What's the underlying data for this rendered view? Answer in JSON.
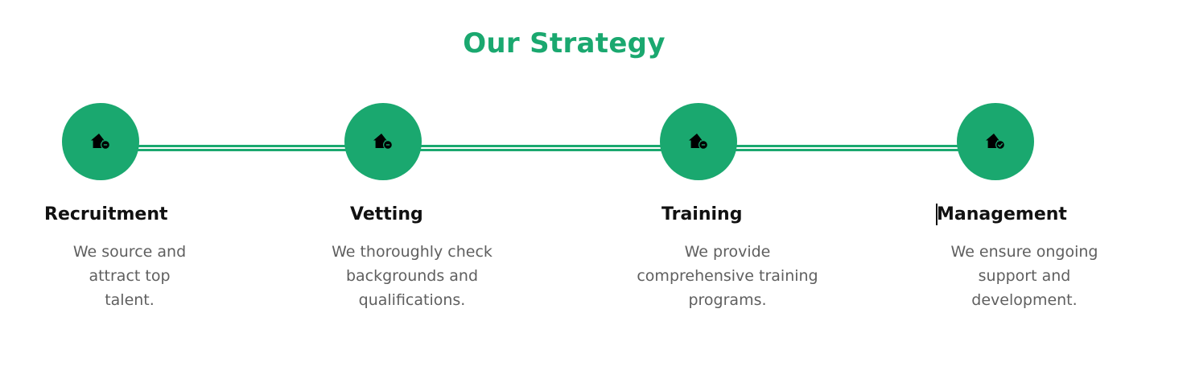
{
  "section": {
    "title": "Our Strategy"
  },
  "colors": {
    "accent": "#1aa86f",
    "heading": "#111111",
    "body_text": "#5f5f5f"
  },
  "steps": [
    {
      "icon": "house-clock-icon",
      "heading": "Recruitment",
      "description": "We source and attract top talent."
    },
    {
      "icon": "house-clock-icon",
      "heading": "Vetting",
      "description": "We thoroughly check backgrounds and qualifications."
    },
    {
      "icon": "house-clock-icon",
      "heading": "Training",
      "description": "We provide comprehensive training programs."
    },
    {
      "icon": "house-check-icon",
      "heading": "Management",
      "description": "We ensure ongoing support and development."
    }
  ]
}
